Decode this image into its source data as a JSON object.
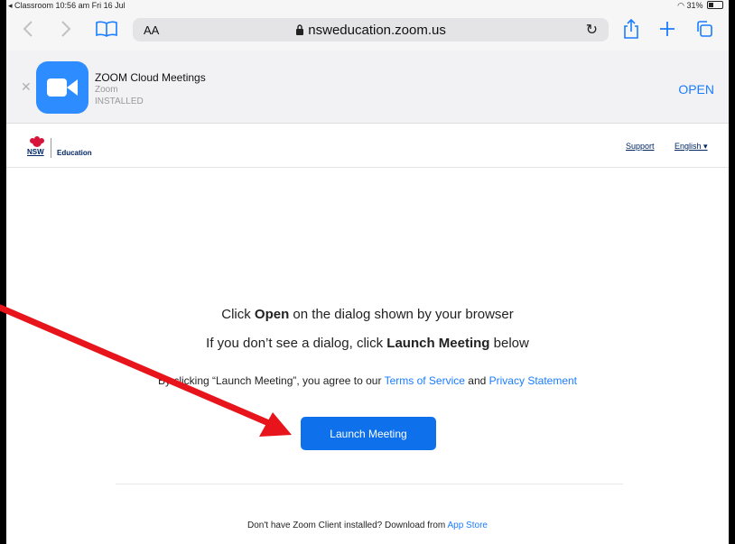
{
  "status_bar": {
    "back_app": "◂ Classroom",
    "time": "10:56 am",
    "date": "Fri 16 Jul",
    "battery": "31%"
  },
  "toolbar": {
    "text_size_label": "AA",
    "url": "nsweducation.zoom.us"
  },
  "app_banner": {
    "app_name": "ZOOM Cloud Meetings",
    "developer": "Zoom",
    "status": "INSTALLED",
    "open_label": "OPEN"
  },
  "site_header": {
    "logo_text": "NSW",
    "department": "Education",
    "support_link": "Support",
    "language": "English"
  },
  "main": {
    "line1_pre": "Click ",
    "line1_bold": "Open",
    "line1_post": " on the dialog shown by your browser",
    "line2_pre": "If you don’t see a dialog, click ",
    "line2_bold": "Launch Meeting",
    "line2_post": " below",
    "agree_pre": "By clicking “Launch Meeting”, you agree to our ",
    "terms_link": "Terms of Service",
    "agree_and": " and ",
    "privacy_link": "Privacy Statement",
    "launch_button": "Launch Meeting",
    "download_pre": "Don't have Zoom Client installed? Download from ",
    "app_store_link": "App Store"
  },
  "colors": {
    "accent": "#1a7cff",
    "zoom_blue": "#2d8cff",
    "button_blue": "#0e71eb",
    "nsw_navy": "#002664",
    "annotation_red": "#e8141b"
  }
}
